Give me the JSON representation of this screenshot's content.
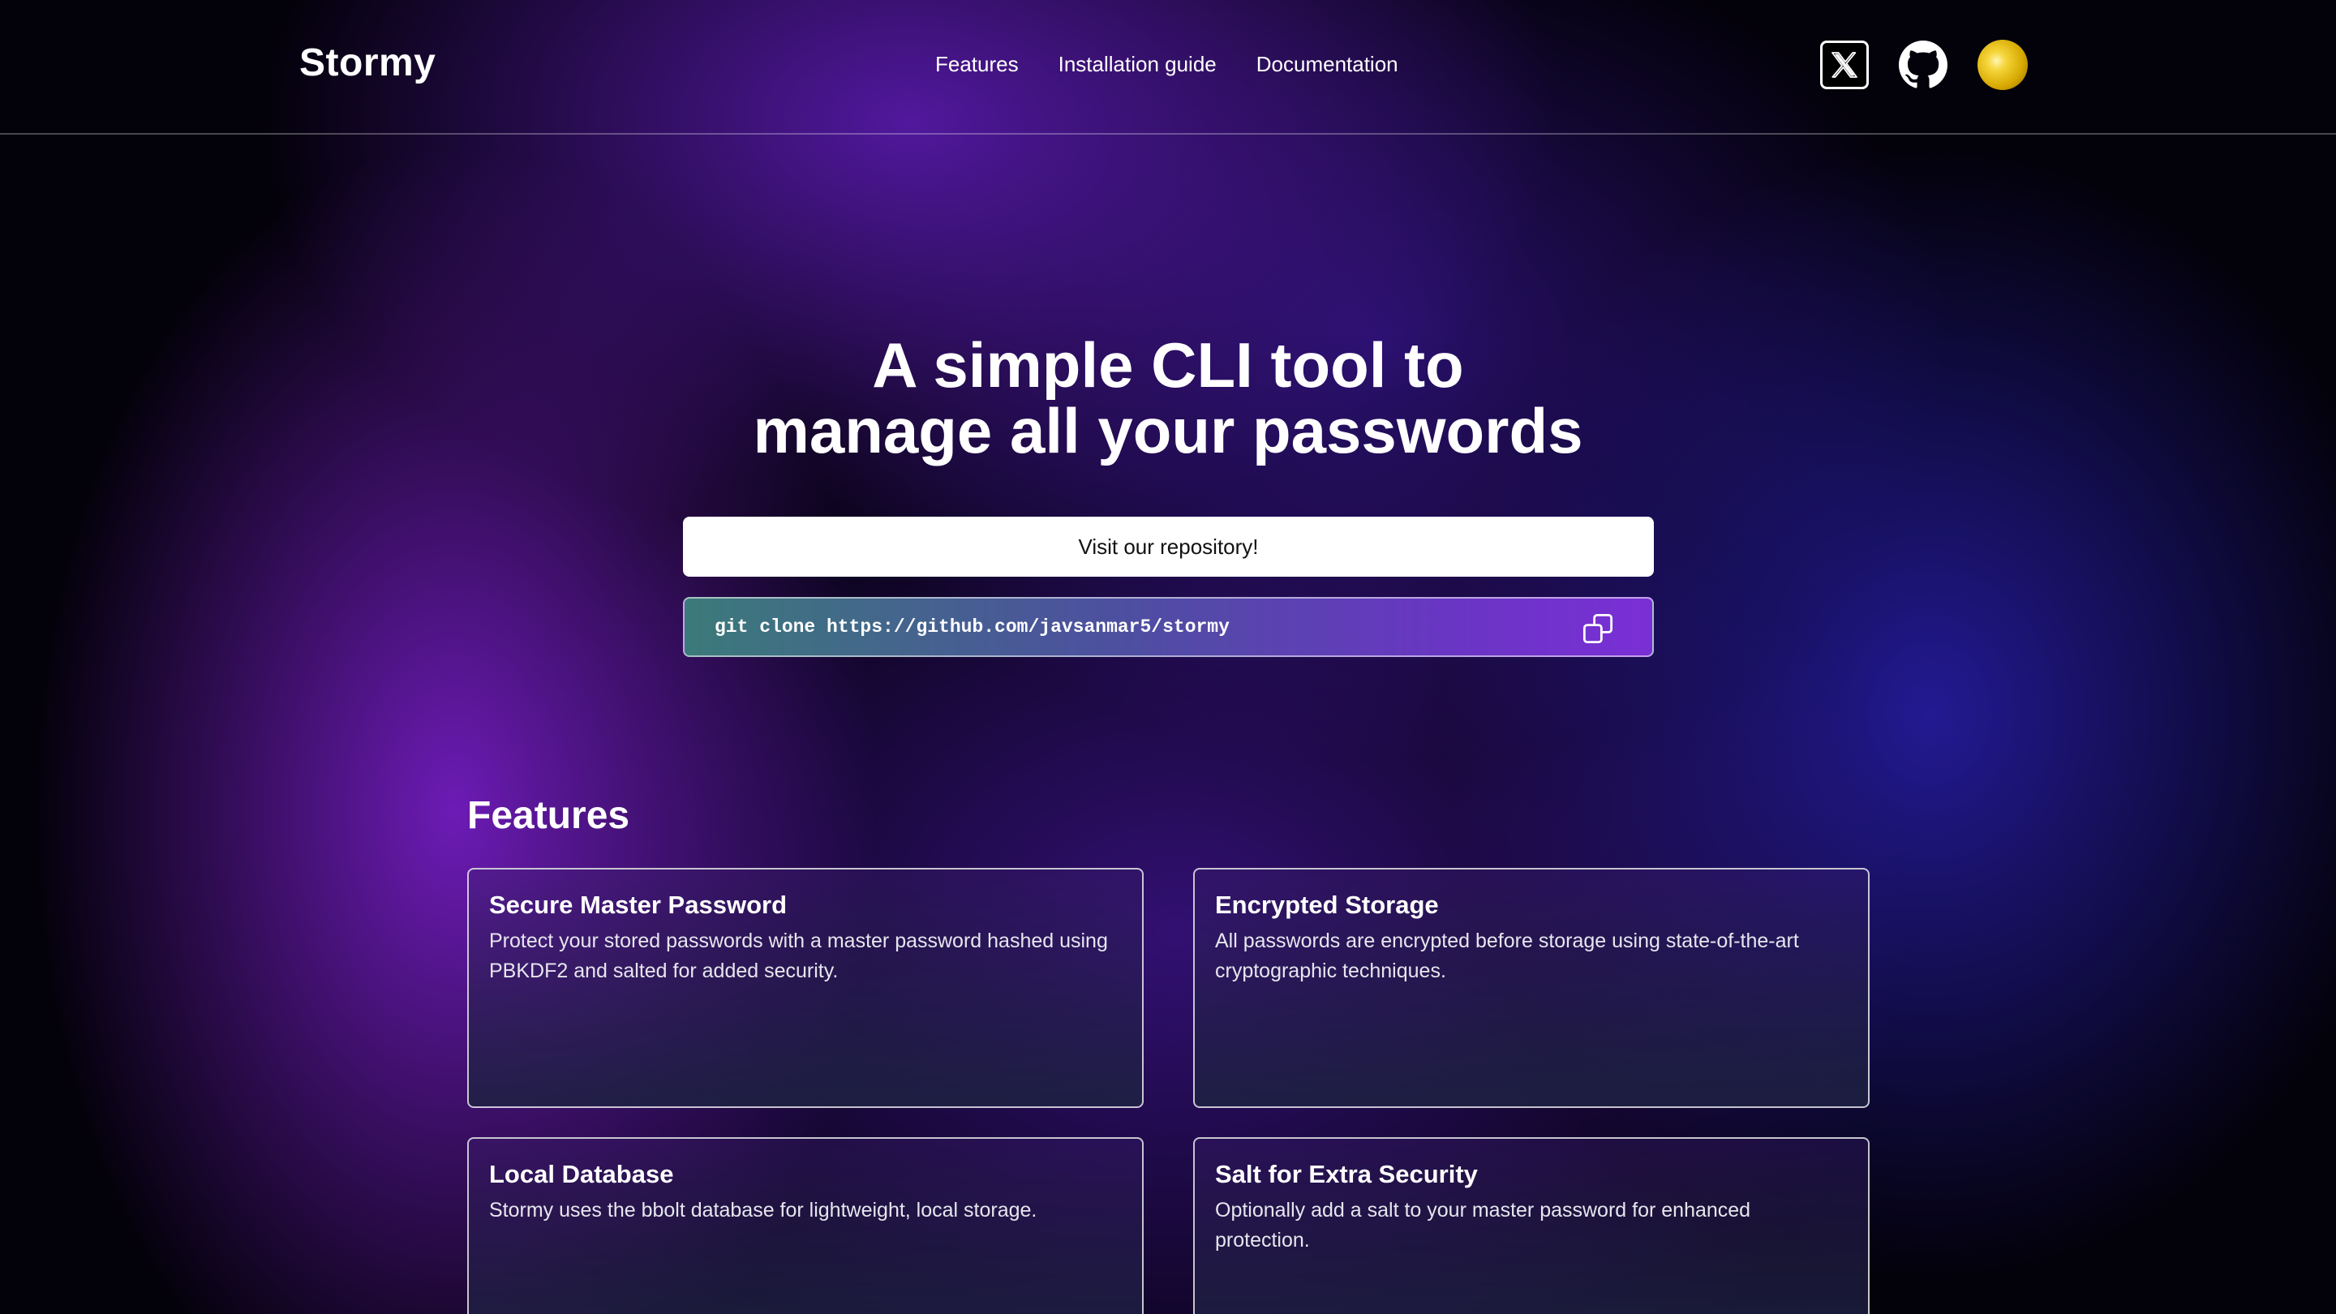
{
  "header": {
    "brand": "Stormy",
    "nav": {
      "features": "Features",
      "installation": "Installation guide",
      "documentation": "Documentation"
    },
    "icons": [
      "x-icon",
      "github-icon",
      "avatar"
    ]
  },
  "hero": {
    "title_line1": "A simple CLI tool to",
    "title_line2": "manage all your passwords",
    "repo_button": "Visit our repository!",
    "clone_command": "git clone https://github.com/javsanmar5/stormy",
    "copy_icon": "copy-icon"
  },
  "features": {
    "heading": "Features",
    "cards": [
      {
        "title": "Secure Master Password",
        "description": "Protect your stored passwords with a master password hashed using PBKDF2 and salted for added security."
      },
      {
        "title": "Encrypted Storage",
        "description": "All passwords are encrypted before storage using state-of-the-art cryptographic techniques."
      },
      {
        "title": "Local Database",
        "description": "Stormy uses the bbolt database for lightweight, local storage."
      },
      {
        "title": "Salt for Extra Security",
        "description": "Optionally add a salt to your master password for enhanced protection."
      }
    ]
  },
  "colors": {
    "background": "#03010a",
    "accent_purple": "#6a1fb8",
    "accent_blue": "#2a1fa8",
    "avatar_gold": "#d6a800"
  }
}
